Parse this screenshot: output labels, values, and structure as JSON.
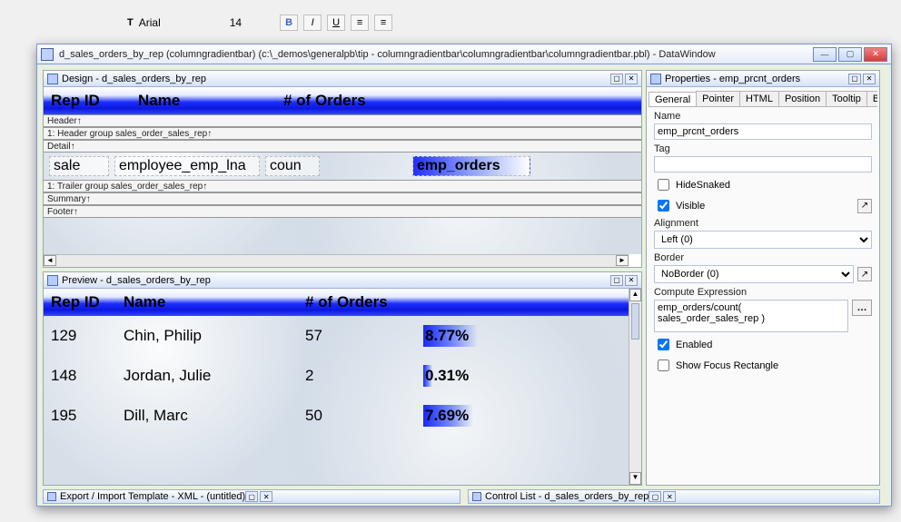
{
  "toolbar": {
    "font": "Arial",
    "font_size": "14"
  },
  "window": {
    "title": "d_sales_orders_by_rep  (columngradientbar)  (c:\\_demos\\generalpb\\tip - columngradientbar\\columngradientbar\\columngradientbar.pbl)  -  DataWindow"
  },
  "design": {
    "title": "Design - d_sales_orders_by_rep",
    "columns": {
      "rep_id": "Rep ID",
      "name": "Name",
      "orders": "# of Orders"
    },
    "bands": {
      "header": "Header↑",
      "group_header": "1: Header group sales_order_sales_rep↑",
      "detail": "Detail↑",
      "group_trailer": "1: Trailer group sales_order_sales_rep↑",
      "summary": "Summary↑",
      "footer": "Footer↑"
    },
    "detail_fields": {
      "f1": "sale",
      "f2": "employee_emp_lna",
      "f3": "coun",
      "f4": "emp_orders"
    }
  },
  "preview": {
    "title": "Preview - d_sales_orders_by_rep",
    "columns": {
      "rep_id": "Rep ID",
      "name": "Name",
      "orders": "# of Orders"
    },
    "rows": [
      {
        "rep_id": "129",
        "name": "Chin, Philip",
        "orders": "57",
        "pct": "8.77%",
        "pct_w": 50
      },
      {
        "rep_id": "148",
        "name": "Jordan, Julie",
        "orders": "2",
        "pct": "0.31%",
        "pct_w": 8
      },
      {
        "rep_id": "195",
        "name": "Dill, Marc",
        "orders": "50",
        "pct": "7.69%",
        "pct_w": 46
      }
    ]
  },
  "properties": {
    "title": "Properties - emp_prcnt_orders",
    "tabs": [
      "General",
      "Pointer",
      "HTML",
      "Position",
      "Tooltip",
      "Ba"
    ],
    "name_label": "Name",
    "name_value": "emp_prcnt_orders",
    "tag_label": "Tag",
    "tag_value": "",
    "hidesnaked_label": "HideSnaked",
    "visible_label": "Visible",
    "alignment_label": "Alignment",
    "alignment_value": "Left (0)",
    "border_label": "Border",
    "border_value": "NoBorder (0)",
    "compute_label": "Compute Expression",
    "compute_value": "emp_orders/count( sales_order_sales_rep )",
    "enabled_label": "Enabled",
    "showfocus_label": "Show Focus Rectangle"
  },
  "export_panel": {
    "title": "Export / Import Template - XML - (untitled)"
  },
  "control_panel": {
    "title": "Control List - d_sales_orders_by_rep"
  }
}
